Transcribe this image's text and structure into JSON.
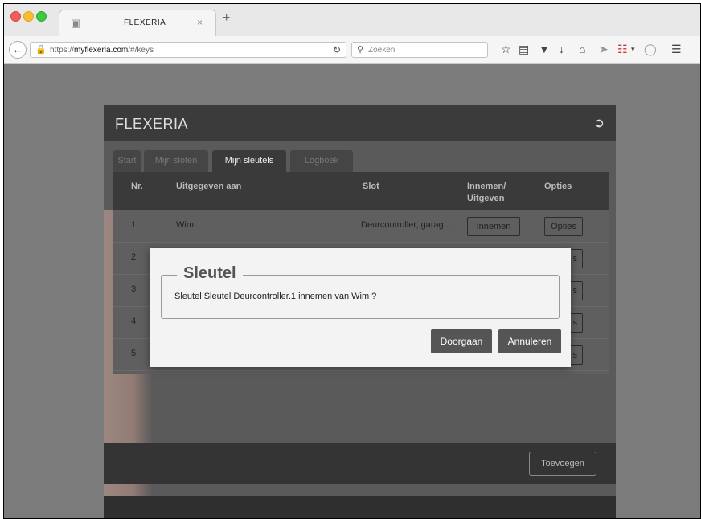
{
  "browser": {
    "tab_title": "FLEXERIA",
    "url_prefix": "https://",
    "url_host": "myflexeria.com",
    "url_path": "/#/keys",
    "search_placeholder": "Zoeken"
  },
  "app": {
    "title": "FLEXERIA",
    "tabs": [
      {
        "label": "Start",
        "active": false
      },
      {
        "label": "Mijn sloten",
        "active": false
      },
      {
        "label": "Mijn sleutels",
        "active": true
      },
      {
        "label": "Logboek",
        "active": false
      }
    ],
    "table": {
      "headers": {
        "nr": "Nr.",
        "issued_to": "Uitgegeven aan",
        "lock": "Slot",
        "take_issue_1": "Innemen/",
        "take_issue_2": "Uitgeven",
        "options": "Opties"
      },
      "rows": [
        {
          "nr": "1",
          "issued_to": "Wim",
          "lock": "Deurcontroller, garag...",
          "action": "Innemen",
          "options": "Opties"
        },
        {
          "nr": "2"
        },
        {
          "nr": "3"
        },
        {
          "nr": "4"
        },
        {
          "nr": "5"
        }
      ],
      "partial_options_text": "s"
    },
    "add_button": "Toevoegen"
  },
  "modal": {
    "title": "Sleutel",
    "message": "Sleutel Sleutel Deurcontroller.1 innemen van Wim ?",
    "confirm": "Doorgaan",
    "cancel": "Annuleren"
  }
}
